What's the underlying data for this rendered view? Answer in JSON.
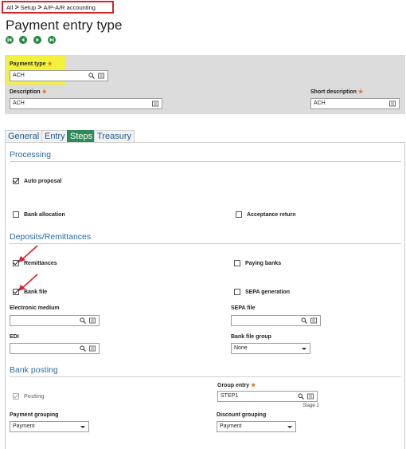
{
  "breadcrumb": [
    "All",
    "Setup",
    "A/P-A/R accounting"
  ],
  "page_title": "Payment entry type",
  "nav_buttons": [
    "first-icon",
    "previous-icon",
    "next-icon",
    "last-icon"
  ],
  "header": {
    "payment_type": {
      "label": "Payment type",
      "value": "ACH"
    },
    "description": {
      "label": "Description",
      "value": "ACH"
    },
    "short_description": {
      "label": "Short description",
      "value": "ACH"
    }
  },
  "tabs": [
    "General",
    "Entry",
    "Steps",
    "Treasury"
  ],
  "active_tab": "Steps",
  "sections": {
    "processing": {
      "title": "Processing",
      "auto_proposal": {
        "label": "Auto proposal",
        "checked": true
      },
      "bank_allocation": {
        "label": "Bank allocation",
        "checked": false
      },
      "acceptance_return": {
        "label": "Acceptance return",
        "checked": false
      }
    },
    "deposits": {
      "title": "Deposits/Remittances",
      "remittances": {
        "label": "Remittances",
        "checked": true
      },
      "paying_banks": {
        "label": "Paying banks",
        "checked": false
      },
      "bank_file": {
        "label": "Bank file",
        "checked": true
      },
      "sepa_generation": {
        "label": "SEPA generation",
        "checked": false
      },
      "electronic_medium": {
        "label": "Electronic medium",
        "value": ""
      },
      "sepa_file": {
        "label": "SEPA file",
        "value": ""
      },
      "edi": {
        "label": "EDI",
        "value": ""
      },
      "bank_file_group": {
        "label": "Bank file group",
        "value": "None"
      }
    },
    "bank_posting": {
      "title": "Bank posting",
      "posting": {
        "label": "Posting",
        "checked": true,
        "disabled": true
      },
      "group_entry": {
        "label": "Group entry",
        "value": "STEP1",
        "note": "Stage 1"
      },
      "payment_grouping": {
        "label": "Payment grouping",
        "value": "Payment"
      },
      "discount_grouping": {
        "label": "Discount grouping",
        "value": "Payment"
      }
    }
  },
  "required_marker": "★",
  "colors": {
    "accent": "#2e8b57",
    "section_title": "#2a6aa3",
    "highlight": "#f4f13c",
    "annotation": "#d6232e"
  }
}
